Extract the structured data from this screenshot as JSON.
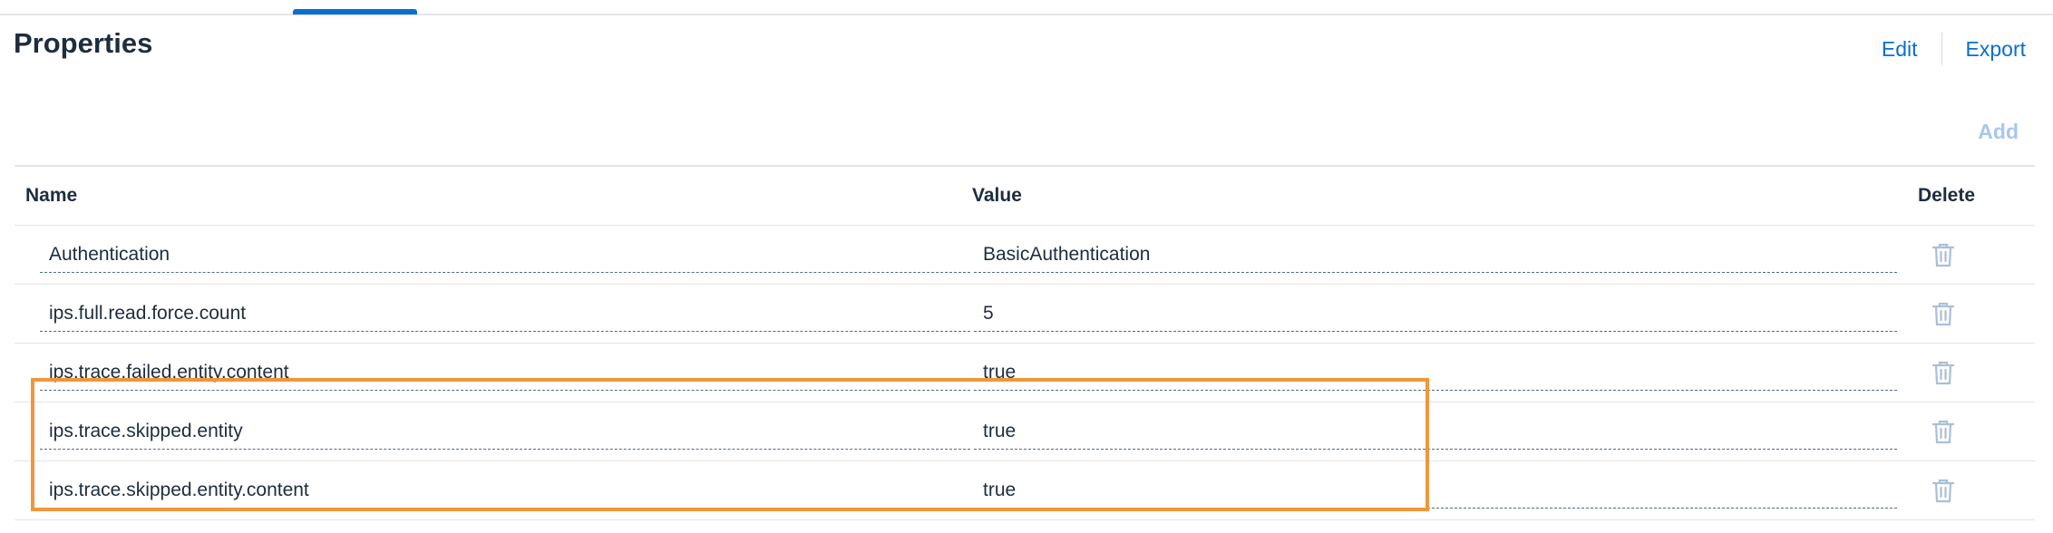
{
  "page": {
    "title": "Properties"
  },
  "header_actions": {
    "edit_label": "Edit",
    "export_label": "Export"
  },
  "toolbar": {
    "add_label": "Add"
  },
  "table": {
    "columns": {
      "name": "Name",
      "value": "Value",
      "delete": "Delete"
    },
    "rows": [
      {
        "name": "Authentication",
        "value": "BasicAuthentication"
      },
      {
        "name": "ips.full.read.force.count",
        "value": "5"
      },
      {
        "name": "ips.trace.failed.entity.content",
        "value": "true"
      },
      {
        "name": "ips.trace.skipped.entity",
        "value": "true"
      },
      {
        "name": "ips.trace.skipped.entity.content",
        "value": "true"
      }
    ]
  },
  "icons": {
    "row_delete": "trash-icon"
  },
  "colors": {
    "accent": "#0a6ed1",
    "add_disabled": "#a8c6ee",
    "delete_icon": "#a9bfd9",
    "highlight": "#f0963c"
  }
}
